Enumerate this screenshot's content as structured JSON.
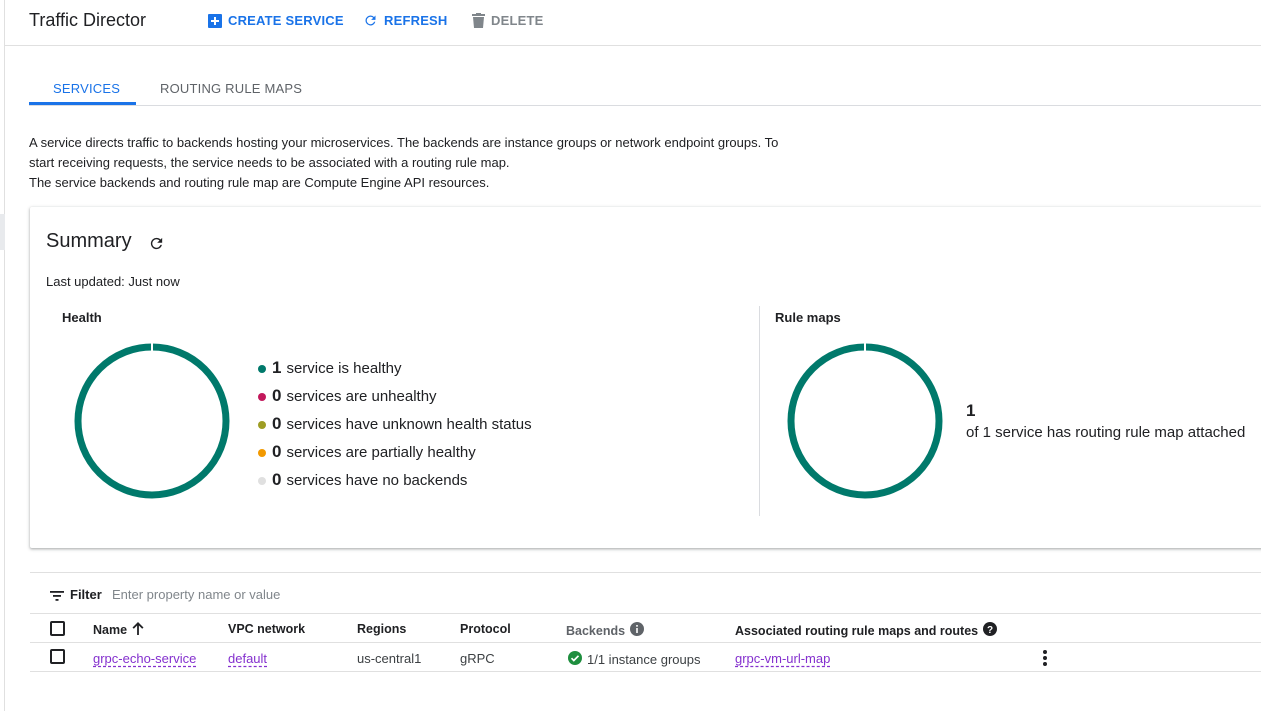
{
  "header": {
    "title": "Traffic Director",
    "create_label": "CREATE SERVICE",
    "refresh_label": "REFRESH",
    "delete_label": "DELETE"
  },
  "tabs": [
    {
      "label": "SERVICES",
      "active": true
    },
    {
      "label": "ROUTING RULE MAPS",
      "active": false
    }
  ],
  "description": {
    "line1": "A service directs traffic to backends hosting your microservices. The backends are instance groups or network endpoint groups. To",
    "line2": "start receiving requests, the service needs to be associated with a routing rule map.",
    "line3": "The service backends and routing rule map are Compute Engine API resources."
  },
  "summary": {
    "title": "Summary",
    "last_updated": "Last updated: Just now",
    "health": {
      "label": "Health",
      "items": [
        {
          "count": "1",
          "text": "service is healthy",
          "color": "#00796b"
        },
        {
          "count": "0",
          "text": "services are unhealthy",
          "color": "#c2185b"
        },
        {
          "count": "0",
          "text": "services have unknown health status",
          "color": "#9e9d24"
        },
        {
          "count": "0",
          "text": "services are partially healthy",
          "color": "#f29900"
        },
        {
          "count": "0",
          "text": "services have no backends",
          "color": "#e0e0e0"
        }
      ]
    },
    "rule_maps": {
      "label": "Rule maps",
      "count": "1",
      "text": "of 1 service has routing rule map attached",
      "color": "#00796b"
    }
  },
  "filter": {
    "label": "Filter",
    "placeholder": "Enter property name or value"
  },
  "table": {
    "headers": {
      "name": "Name",
      "vpc": "VPC network",
      "regions": "Regions",
      "protocol": "Protocol",
      "backends": "Backends",
      "routing": "Associated routing rule maps and routes"
    },
    "rows": [
      {
        "name": "grpc-echo-service",
        "vpc": "default",
        "regions": "us-central1",
        "protocol": "gRPC",
        "backends": "1/1 instance groups",
        "routing": "grpc-vm-url-map"
      }
    ]
  },
  "colors": {
    "accent": "#1a73e8",
    "healthy": "#00796b",
    "link": "#8430ce",
    "check": "#1e8e3e"
  }
}
